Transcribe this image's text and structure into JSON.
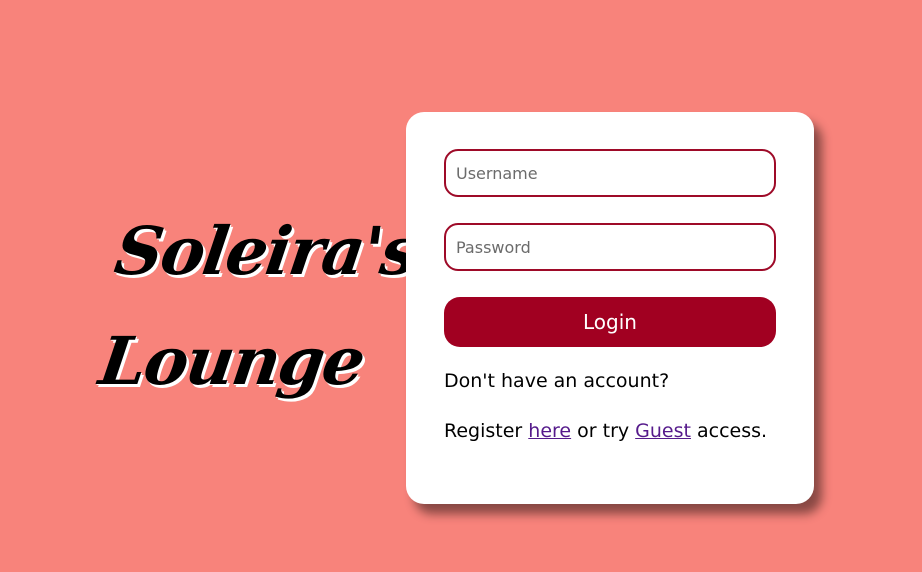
{
  "logo": {
    "line1": "Soleira's",
    "line2": "Lounge"
  },
  "login_form": {
    "username_placeholder": "Username",
    "password_placeholder": "Password",
    "login_label": "Login",
    "no_account_text": "Don't have an account?",
    "register_prefix": "Register ",
    "register_link": "here",
    "middle_text": " or try ",
    "guest_link": "Guest",
    "suffix_text": " access."
  },
  "colors": {
    "background": "#f8837b",
    "accent": "#a10021",
    "link": "#551a8b"
  }
}
